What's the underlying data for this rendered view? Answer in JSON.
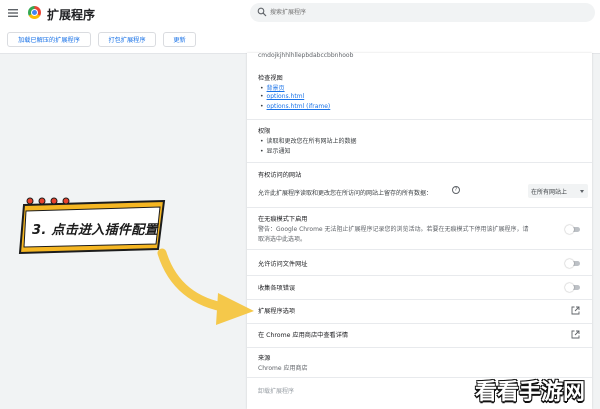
{
  "header": {
    "title": "扩展程序",
    "search_placeholder": "搜索扩展程序"
  },
  "toolbar": {
    "load_unpacked": "加载已解压的扩展程序",
    "pack_extension": "打包扩展程序",
    "update": "更新"
  },
  "details": {
    "extension_id": "cmdojkjhhlhllepbdabccbbnhoob",
    "inspect_views": {
      "title": "检查视图",
      "items": [
        "背景页",
        "options.html",
        "options.html (iframe)"
      ]
    },
    "permissions": {
      "title": "权限",
      "items": [
        "读取和更改您在所有网站上的数据",
        "显示通知"
      ]
    },
    "site_access": {
      "title": "有权访问的网站",
      "description": "允许此扩展程序读取和更改您在所访问的网站上留存的所有数据：",
      "dropdown_value": "在所有网站上"
    },
    "incognito": {
      "title": "在无痕模式下启用",
      "warning_line1": "警告：Google Chrome 无法阻止扩展程序记录您的浏览活动。若要在无痕模式下停用该扩展程序，请",
      "warning_line2": "取消选中此选项。",
      "enabled": false
    },
    "file_urls": {
      "label": "允许访问文件网址",
      "enabled": false
    },
    "collect_errors": {
      "label": "收集各项错误",
      "enabled": false
    },
    "extension_options": "扩展程序选项",
    "view_in_store": "在 Chrome 应用商店中查看详情",
    "source": {
      "title": "来源",
      "value": "Chrome 应用商店"
    },
    "uninstall": "卸载扩展程序"
  },
  "annotation": {
    "step_text": "3. 点击进入插件配置",
    "banner_color": "#f5b622",
    "arrow_color": "#f5c84a"
  },
  "watermark": "看看手游网",
  "colors": {
    "accent": "#1a73e8",
    "background": "#f1f3f4"
  }
}
